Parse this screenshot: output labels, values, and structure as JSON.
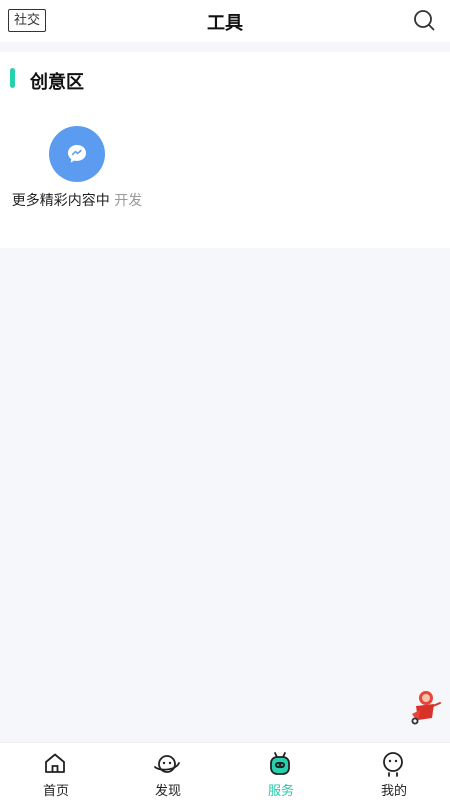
{
  "header": {
    "social_button": "社交",
    "title": "工具",
    "search_icon": "search-icon"
  },
  "section": {
    "title": "创意区",
    "accent_color": "#27d1b0",
    "tools": [
      {
        "label": "更多精彩内容中",
        "status": "开发",
        "icon": "chat-bubble-icon",
        "icon_color": "#5c9cf0"
      }
    ]
  },
  "tabbar": {
    "active_color": "#27c9a8",
    "tabs": [
      {
        "label": "首页",
        "icon": "home-icon"
      },
      {
        "label": "发现",
        "icon": "planet-icon"
      },
      {
        "label": "服务",
        "icon": "service-robot-icon",
        "active": true
      },
      {
        "label": "我的",
        "icon": "profile-face-icon"
      }
    ]
  }
}
